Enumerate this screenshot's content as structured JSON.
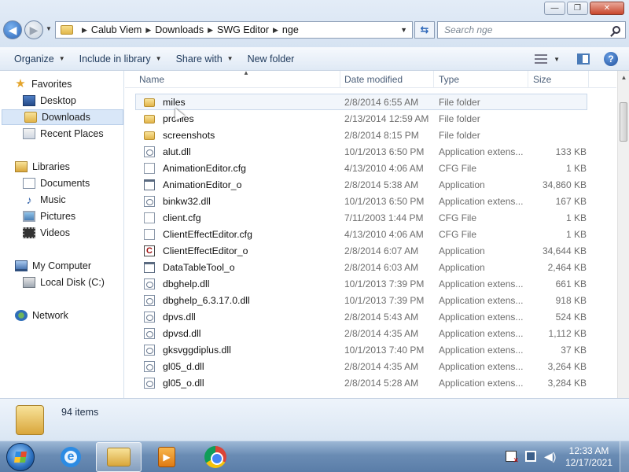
{
  "window": {
    "minimize_glyph": "—",
    "maximize_glyph": "❐",
    "close_glyph": "✕"
  },
  "address": {
    "crumbs": [
      "Calub Viem",
      "Downloads",
      "SWG Editor",
      "nge"
    ],
    "separator": "▶",
    "dropdown_glyph": "▼"
  },
  "search": {
    "placeholder": "Search nge"
  },
  "toolbar": {
    "organize": "Organize",
    "include_in_library": "Include in library",
    "share_with": "Share with",
    "new_folder": "New folder"
  },
  "nav": {
    "favorites": "Favorites",
    "desktop": "Desktop",
    "downloads": "Downloads",
    "recent_places": "Recent Places",
    "libraries": "Libraries",
    "documents": "Documents",
    "music": "Music",
    "pictures": "Pictures",
    "videos": "Videos",
    "my_computer": "My Computer",
    "local_disk": "Local Disk (C:)",
    "network": "Network"
  },
  "columns": {
    "name": "Name",
    "date_modified": "Date modified",
    "type": "Type",
    "size": "Size"
  },
  "files": [
    {
      "name": "miles",
      "date": "2/8/2014 6:55 AM",
      "type": "File folder",
      "size": "",
      "icon": "folder"
    },
    {
      "name": "profiles",
      "date": "2/13/2014 12:59 AM",
      "type": "File folder",
      "size": "",
      "icon": "folder"
    },
    {
      "name": "screenshots",
      "date": "2/8/2014 8:15 PM",
      "type": "File folder",
      "size": "",
      "icon": "folder"
    },
    {
      "name": "alut.dll",
      "date": "10/1/2013 6:50 PM",
      "type": "Application extens...",
      "size": "133 KB",
      "icon": "dll"
    },
    {
      "name": "AnimationEditor.cfg",
      "date": "4/13/2010 4:06 AM",
      "type": "CFG File",
      "size": "1 KB",
      "icon": "cfg"
    },
    {
      "name": "AnimationEditor_o",
      "date": "2/8/2014 5:38 AM",
      "type": "Application",
      "size": "34,860 KB",
      "icon": "app"
    },
    {
      "name": "binkw32.dll",
      "date": "10/1/2013 6:50 PM",
      "type": "Application extens...",
      "size": "167 KB",
      "icon": "dll"
    },
    {
      "name": "client.cfg",
      "date": "7/11/2003 1:44 PM",
      "type": "CFG File",
      "size": "1 KB",
      "icon": "cfg"
    },
    {
      "name": "ClientEffectEditor.cfg",
      "date": "4/13/2010 4:06 AM",
      "type": "CFG File",
      "size": "1 KB",
      "icon": "cfg"
    },
    {
      "name": "ClientEffectEditor_o",
      "date": "2/8/2014 6:07 AM",
      "type": "Application",
      "size": "34,644 KB",
      "icon": "c"
    },
    {
      "name": "DataTableTool_o",
      "date": "2/8/2014 6:03 AM",
      "type": "Application",
      "size": "2,464 KB",
      "icon": "app"
    },
    {
      "name": "dbghelp.dll",
      "date": "10/1/2013 7:39 PM",
      "type": "Application extens...",
      "size": "661 KB",
      "icon": "dll"
    },
    {
      "name": "dbghelp_6.3.17.0.dll",
      "date": "10/1/2013 7:39 PM",
      "type": "Application extens...",
      "size": "918 KB",
      "icon": "dll"
    },
    {
      "name": "dpvs.dll",
      "date": "2/8/2014 5:43 AM",
      "type": "Application extens...",
      "size": "524 KB",
      "icon": "dll"
    },
    {
      "name": "dpvsd.dll",
      "date": "2/8/2014 4:35 AM",
      "type": "Application extens...",
      "size": "1,112 KB",
      "icon": "dll"
    },
    {
      "name": "gksvggdiplus.dll",
      "date": "10/1/2013 7:40 PM",
      "type": "Application extens...",
      "size": "37 KB",
      "icon": "dll"
    },
    {
      "name": "gl05_d.dll",
      "date": "2/8/2014 4:35 AM",
      "type": "Application extens...",
      "size": "3,264 KB",
      "icon": "dll"
    },
    {
      "name": "gl05_o.dll",
      "date": "2/8/2014 5:28 AM",
      "type": "Application extens...",
      "size": "3,284 KB",
      "icon": "dll"
    }
  ],
  "details": {
    "item_count": "94 items"
  },
  "taskbar": {
    "time": "12:33 AM",
    "date": "12/17/2021",
    "media_glyph": "▶"
  }
}
